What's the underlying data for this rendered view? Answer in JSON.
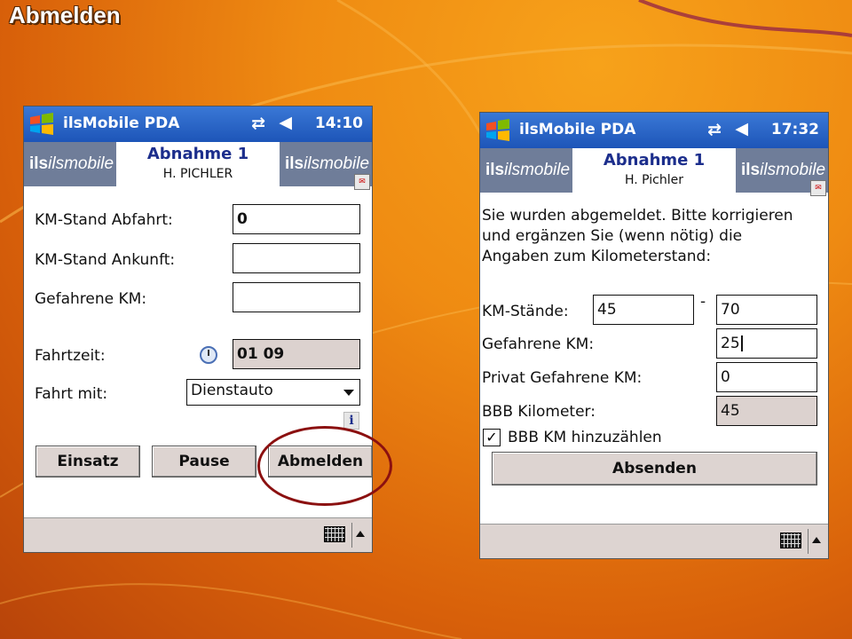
{
  "slide": {
    "title": "Abmelden"
  },
  "screen1": {
    "titlebar": {
      "app": "ilsMobile PDA",
      "time": "14:10"
    },
    "header": {
      "title": "Abnahme 1",
      "subtitle": "H. PICHLER",
      "logo": "ilsmobile"
    },
    "fields": {
      "km_abfahrt_label": "KM-Stand Abfahrt:",
      "km_abfahrt_value": "0",
      "km_ankunft_label": "KM-Stand Ankunft:",
      "km_ankunft_value": "",
      "gefahrene_label": "Gefahrene KM:",
      "gefahrene_value": "",
      "fahrzeit_label": "Fahrtzeit:",
      "fahrzeit_value": "01 09",
      "fahrt_mit_label": "Fahrt mit:",
      "fahrt_mit_value": "Dienstauto"
    },
    "buttons": {
      "einsatz": "Einsatz",
      "pause": "Pause",
      "abmelden": "Abmelden"
    }
  },
  "screen2": {
    "titlebar": {
      "app": "ilsMobile PDA",
      "time": "17:32"
    },
    "header": {
      "title": "Abnahme 1",
      "subtitle": "H. Pichler",
      "logo": "ilsmobile"
    },
    "message": {
      "line1": "Sie wurden abgemeldet. Bitte korrigieren",
      "line2": "und ergänzen Sie (wenn nötig) die",
      "line3": "Angaben zum Kilometerstand:"
    },
    "fields": {
      "km_staende_label": "KM-Stände:",
      "km_from": "45",
      "km_dash": "-",
      "km_to": "70",
      "gefahrene_label": "Gefahrene KM:",
      "gefahrene_value": "25",
      "privat_label": "Privat Gefahrene KM:",
      "privat_value": "0",
      "bbb_label": "BBB Kilometer:",
      "bbb_value": "45",
      "bbb_checkbox_label": "BBB KM hinzuzählen",
      "bbb_checked": true
    },
    "buttons": {
      "absenden": "Absenden"
    }
  },
  "icons": {
    "windows": "windows-logo-icon",
    "connectivity": "connectivity-icon",
    "volume": "volume-icon",
    "clock": "clock-icon",
    "info": "info-icon",
    "keyboard": "keyboard-icon"
  }
}
